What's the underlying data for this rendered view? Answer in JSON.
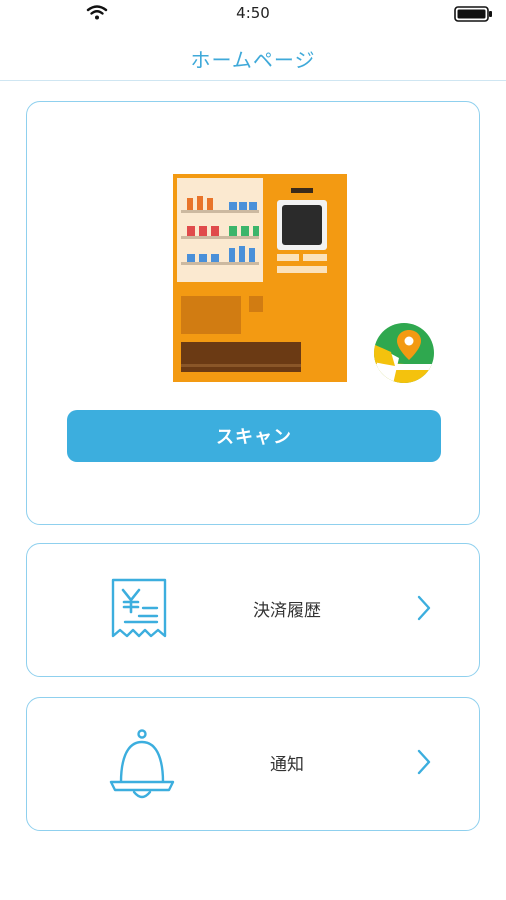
{
  "status_bar": {
    "time": "4:50",
    "icons": [
      "wifi-icon",
      "battery-icon"
    ]
  },
  "header": {
    "title": "ホームページ"
  },
  "main_card": {
    "illustration": "vending-machine-illustration",
    "badge_icon": "map-pin-icon",
    "scan_label": "スキャン"
  },
  "menu": {
    "history_label": "決済履歴",
    "history_icon": "receipt-yen-icon",
    "notice_label": "通知",
    "notice_icon": "bell-icon",
    "chevron_icon": "chevron-right-icon"
  },
  "colors": {
    "accent": "#3caede",
    "border": "#8fd0ee",
    "machine": "#f39a12"
  }
}
